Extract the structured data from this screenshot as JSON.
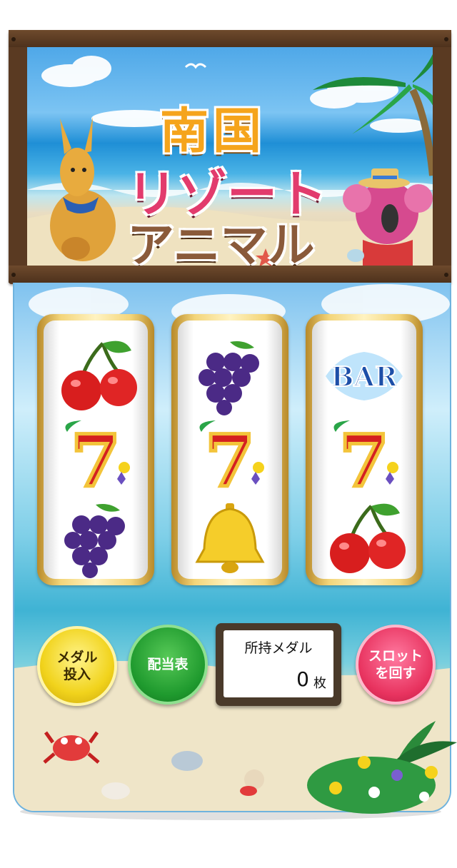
{
  "game": {
    "title_line1": "南国",
    "title_line2": "リゾート",
    "title_line3": "アニマル"
  },
  "reels": [
    {
      "symbols": [
        "cherry",
        "seven",
        "grape"
      ]
    },
    {
      "symbols": [
        "grape",
        "seven",
        "bell"
      ]
    },
    {
      "symbols": [
        "bar",
        "seven",
        "cherry"
      ]
    }
  ],
  "bar_label": "BAR",
  "seven_label": "7",
  "buttons": {
    "medal_label_1": "メダル",
    "medal_label_2": "投入",
    "payout_label": "配当表",
    "spin_label_1": "スロット",
    "spin_label_2": "を回す"
  },
  "medal_counter": {
    "title": "所持メダル",
    "count": "0",
    "unit": "枚"
  },
  "colors": {
    "wood": "#5a3a22",
    "gold": "#f1d31c",
    "green": "#1f9a2e",
    "pink": "#e8335f"
  }
}
